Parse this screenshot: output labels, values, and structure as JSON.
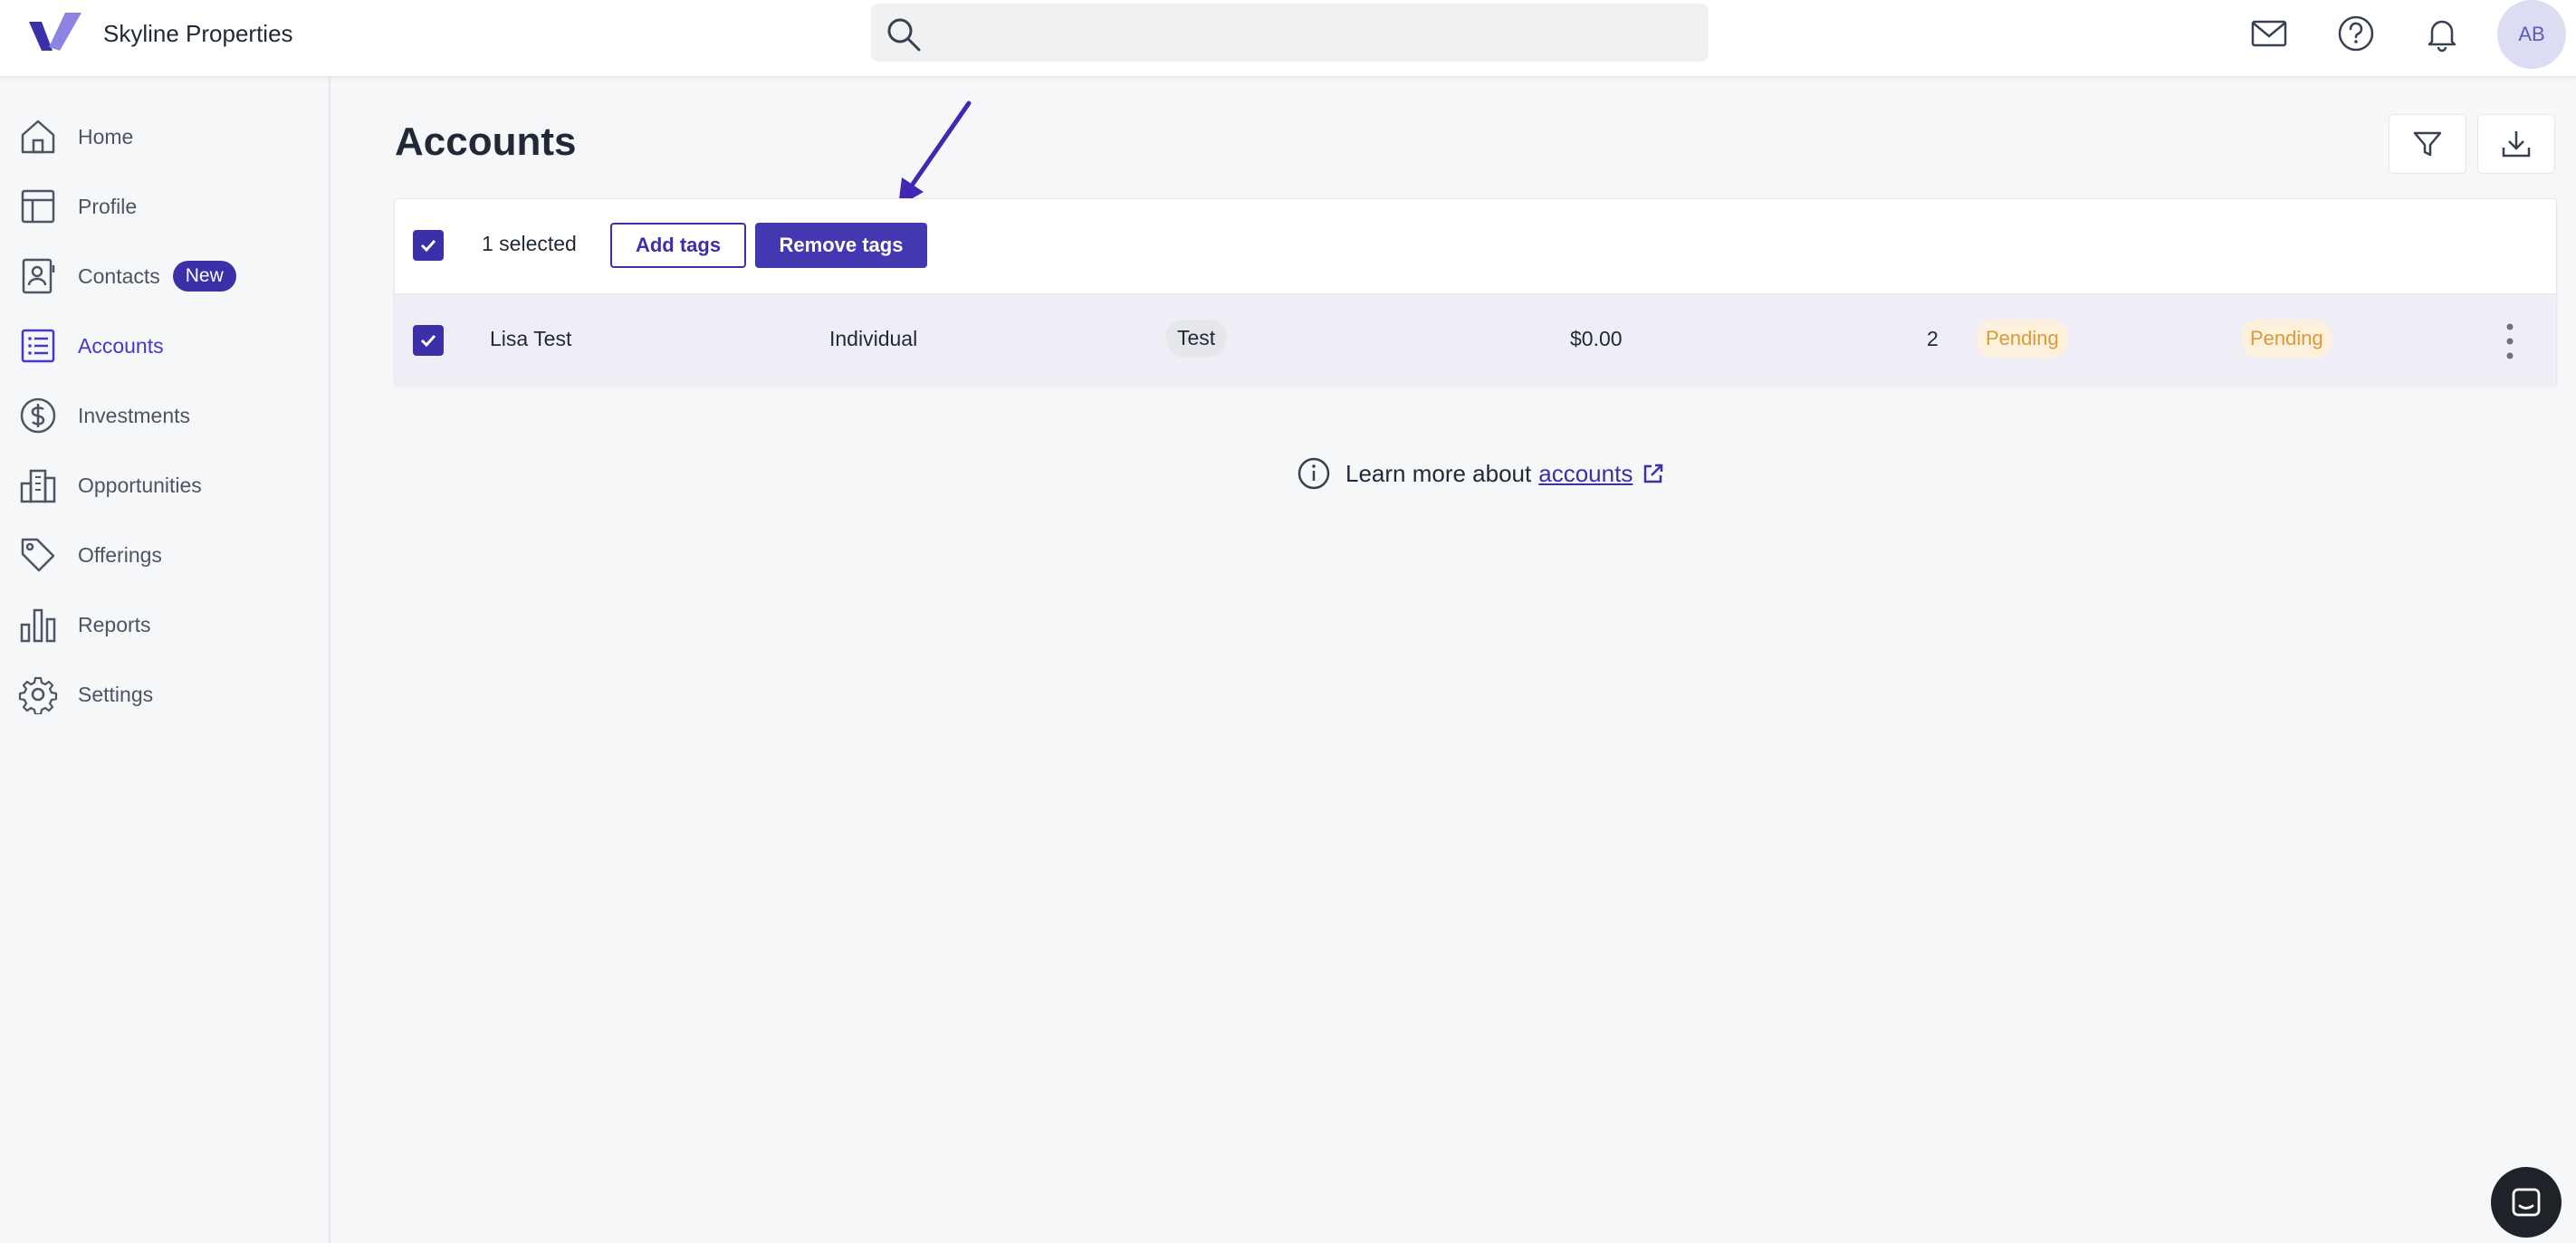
{
  "brand": {
    "name": "Skyline Properties"
  },
  "search": {
    "placeholder": ""
  },
  "header": {
    "avatar_initials": "AB"
  },
  "sidebar": {
    "items": [
      {
        "label": "Home",
        "icon": "home-icon"
      },
      {
        "label": "Profile",
        "icon": "profile-icon"
      },
      {
        "label": "Contacts",
        "icon": "contacts-icon",
        "badge": "New"
      },
      {
        "label": "Accounts",
        "icon": "accounts-icon",
        "active": true
      },
      {
        "label": "Investments",
        "icon": "dollar-icon"
      },
      {
        "label": "Opportunities",
        "icon": "building-icon"
      },
      {
        "label": "Offerings",
        "icon": "tag-icon"
      },
      {
        "label": "Reports",
        "icon": "bar-chart-icon"
      },
      {
        "label": "Settings",
        "icon": "gear-icon"
      }
    ]
  },
  "main": {
    "title": "Accounts",
    "bulk": {
      "selected_text": "1 selected",
      "add_tags": "Add tags",
      "remove_tags": "Remove tags"
    },
    "rows": [
      {
        "name": "Lisa Test",
        "type": "Individual",
        "tag": "Test",
        "amount": "$0.00",
        "count": "2",
        "status1": "Pending",
        "status2": "Pending"
      }
    ],
    "learn": {
      "text": "Learn more about",
      "link": "accounts"
    }
  },
  "colors": {
    "accent": "#3b30a8",
    "pending_bg": "#fdf0dc",
    "pending_text": "#d99a3a"
  }
}
